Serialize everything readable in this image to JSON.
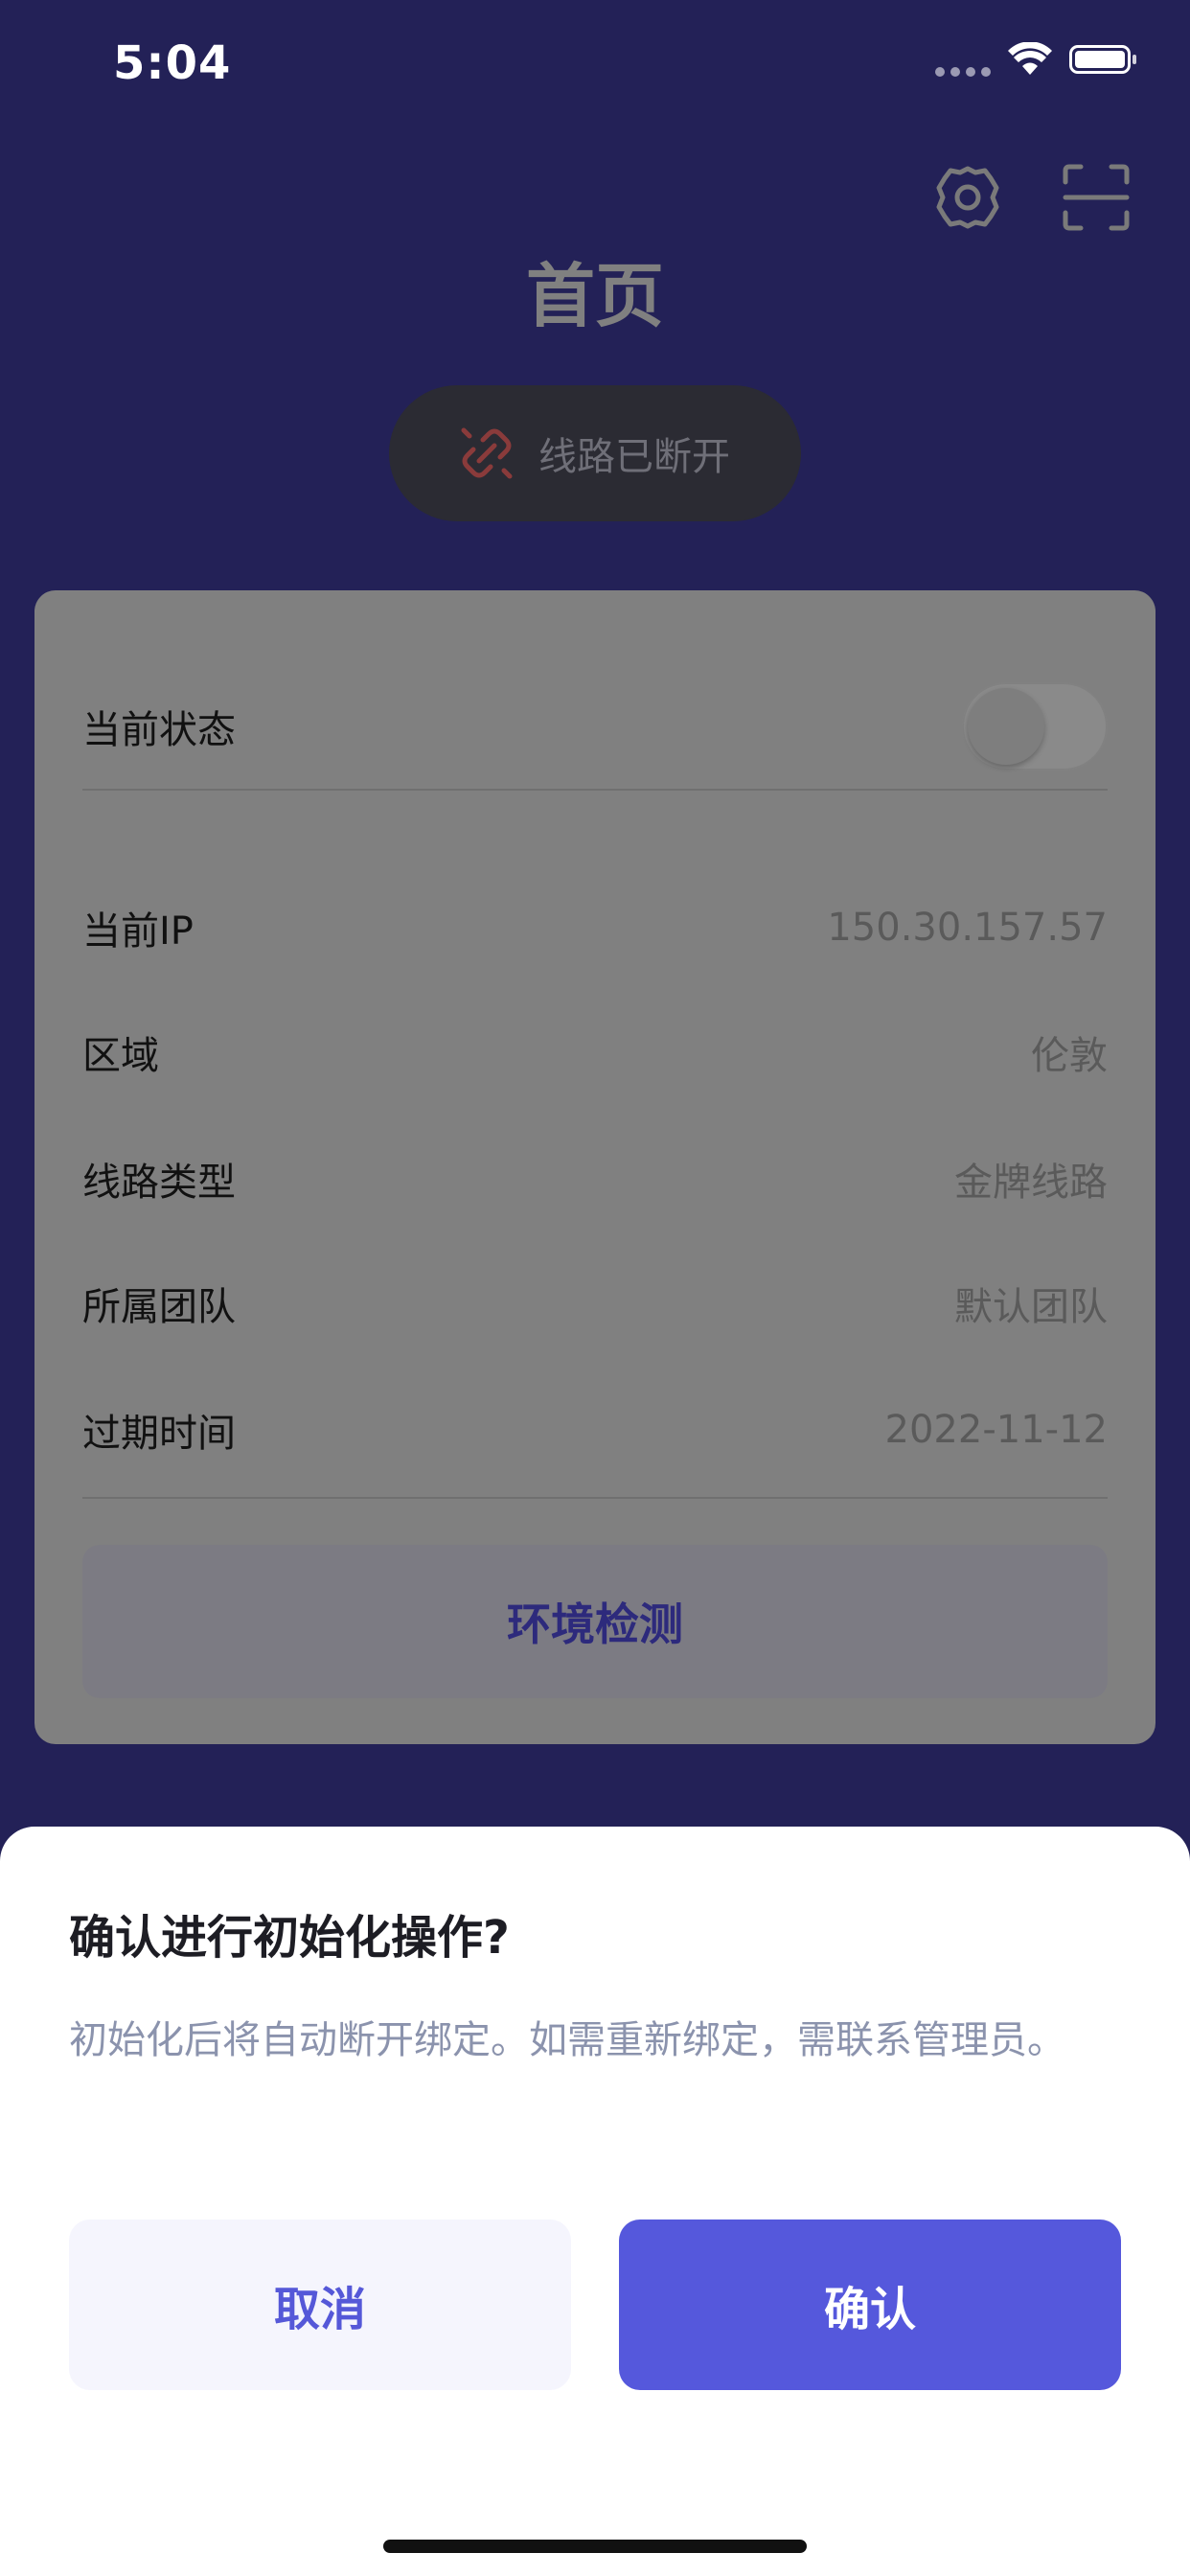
{
  "status_bar": {
    "time": "5:04"
  },
  "header": {
    "title": "首页"
  },
  "line_status": {
    "label": "线路已断开"
  },
  "card": {
    "current_status_label": "当前状态",
    "current_status_on": false,
    "info_rows": [
      {
        "key": "当前IP",
        "value": "150.30.157.57"
      },
      {
        "key": "区域",
        "value": "伦敦"
      },
      {
        "key": "线路类型",
        "value": "金牌线路"
      },
      {
        "key": "所属团队",
        "value": "默认团队"
      },
      {
        "key": "过期时间",
        "value": "2022-11-12"
      }
    ],
    "env_check_label": "环境检测"
  },
  "dialog": {
    "title": "确认进行初始化操作?",
    "message": "初始化后将自动断开绑定。如需重新绑定，需联系管理员。",
    "cancel_label": "取消",
    "confirm_label": "确认"
  },
  "colors": {
    "background": "#232157",
    "accent": "#5558dc",
    "link_broken_icon": "#b24a4a"
  }
}
